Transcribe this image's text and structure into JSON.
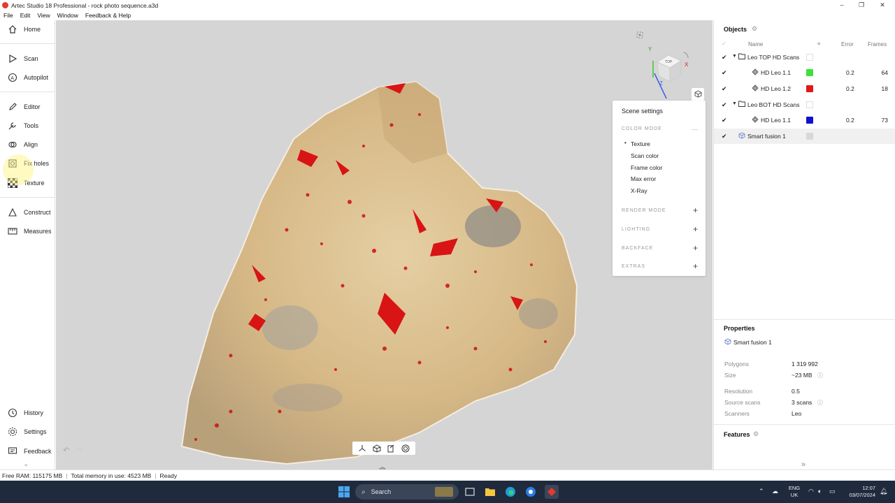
{
  "window": {
    "title": "Artec Studio 18 Professional - rock photo sequence.a3d",
    "controls": {
      "minimize": "–",
      "maximize": "❐",
      "close": "✕"
    }
  },
  "menu": [
    "File",
    "Edit",
    "View",
    "Window",
    "Feedback & Help"
  ],
  "nav": {
    "home": "Home",
    "scan": "Scan",
    "autopilot": "Autopilot",
    "editor": "Editor",
    "tools": "Tools",
    "align": "Align",
    "fix_holes": "Fix holes",
    "texture": "Texture",
    "construct": "Construct",
    "measures": "Measures",
    "history": "History",
    "settings": "Settings",
    "feedback": "Feedback"
  },
  "viewcube": {
    "face": "TOP",
    "x_axis": "X",
    "y_axis": "Y",
    "z_axis": "Z"
  },
  "scene_settings": {
    "title": "Scene settings",
    "color_mode": "COLOR MODE",
    "color_mode_options": [
      "Texture",
      "Scan color",
      "Frame color",
      "Max error",
      "X-Ray"
    ],
    "selected_option": "Texture",
    "render_mode": "RENDER MODE",
    "lighting": "LIGHTING",
    "backface": "BACKFACE",
    "extras": "EXTRAS"
  },
  "objects": {
    "title": "Objects",
    "col_name": "Name",
    "col_error": "Error",
    "col_frames": "Frames",
    "rows": [
      {
        "name": "Leo TOP HD Scans",
        "error": "",
        "frames": "",
        "color": ""
      },
      {
        "name": "HD Leo 1.1",
        "error": "0.2",
        "frames": "64",
        "color": "#3ee03a"
      },
      {
        "name": "HD Leo 1.2",
        "error": "0.2",
        "frames": "18",
        "color": "#e01818"
      },
      {
        "name": "Leo BOT HD Scans",
        "error": "",
        "frames": "",
        "color": ""
      },
      {
        "name": "HD Leo 1.1",
        "error": "0.2",
        "frames": "73",
        "color": "#1010d0"
      },
      {
        "name": "Smart fusion 1",
        "error": "",
        "frames": "",
        "color": "#d8d8d8"
      }
    ]
  },
  "properties": {
    "title": "Properties",
    "object": "Smart fusion 1",
    "polygons_label": "Polygons",
    "polygons": "1 319 992",
    "size_label": "Size",
    "size": "~23 MB",
    "resolution_label": "Resolution",
    "resolution": "0.5",
    "source_scans_label": "Source scans",
    "source_scans": "3 scans",
    "scanners_label": "Scanners",
    "scanners": "Leo"
  },
  "features": {
    "title": "Features"
  },
  "status": {
    "free_ram": "Free RAM: 115175 MB",
    "total_memory": "Total memory in use: 4523 MB",
    "state": "Ready"
  },
  "taskbar": {
    "search": "Search",
    "lang_1": "ENG",
    "lang_2": "UK",
    "time": "12:07",
    "date": "03/07/2024"
  }
}
